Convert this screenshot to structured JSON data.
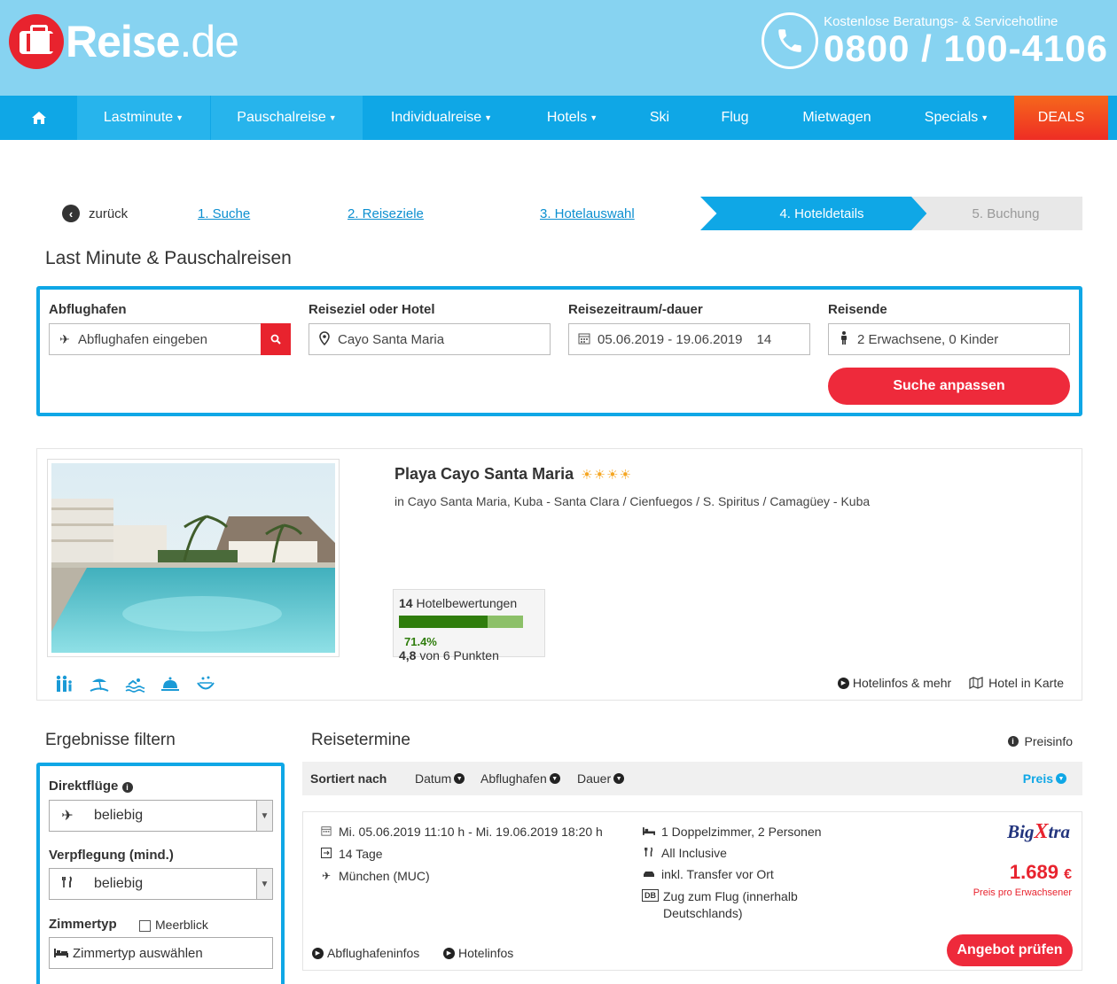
{
  "header": {
    "logo_bold": "Reise",
    "logo_light": ".de",
    "hotline_label": "Kostenlose Beratungs- & Servicehotline",
    "hotline_number": "0800 / 100-4106"
  },
  "nav": {
    "items": [
      {
        "label": "Lastminute"
      },
      {
        "label": "Pauschalreise"
      },
      {
        "label": "Individualreise"
      },
      {
        "label": "Hotels"
      },
      {
        "label": "Ski"
      },
      {
        "label": "Flug"
      },
      {
        "label": "Mietwagen"
      },
      {
        "label": "Specials"
      },
      {
        "label": "DEALS"
      }
    ]
  },
  "steps": {
    "back": "zurück",
    "items": [
      "1. Suche",
      "2. Reiseziele",
      "3. Hotelauswahl",
      "4. Hoteldetails",
      "5. Buchung"
    ]
  },
  "page_title": "Last Minute & Pauschalreisen",
  "search": {
    "departure_label": "Abflughafen",
    "departure_placeholder": "Abflughafen eingeben",
    "destination_label": "Reiseziel oder Hotel",
    "destination_value": "Cayo Santa Maria",
    "period_label": "Reisezeitraum/-dauer",
    "period_value": "05.06.2019 - 19.06.2019",
    "duration_value": "14",
    "travelers_label": "Reisende",
    "travelers_value": "2 Erwachsene, 0 Kinder",
    "submit": "Suche anpassen"
  },
  "hotel": {
    "name": "Playa Cayo Santa Maria",
    "stars": "☀☀☀☀",
    "location": "in Cayo Santa Maria, Kuba - Santa Clara / Cienfuegos / S. Spiritus / Camagüey - Kuba",
    "reviews_count": "14",
    "reviews_label": "Hotelbewertungen",
    "recommend_pct": 71.4,
    "recommend_text": "71.4%",
    "score": "4,8",
    "score_suffix": "von 6 Punkten",
    "link_info": "Hotelinfos & mehr",
    "link_map": "Hotel in Karte",
    "amenities": [
      "family-icon",
      "beach-icon",
      "pool-icon",
      "service-bell-icon",
      "spa-icon"
    ]
  },
  "filter": {
    "title": "Ergebnisse filtern",
    "direct_label": "Direktflüge",
    "direct_value": "beliebig",
    "board_label": "Verpflegung (mind.)",
    "board_value": "beliebig",
    "room_label": "Zimmertyp",
    "seaview_label": "Meerblick",
    "room_placeholder": "Zimmertyp auswählen"
  },
  "results": {
    "title": "Reisetermine",
    "price_info": "Preisinfo",
    "sort_label": "Sortiert nach",
    "sort_options": [
      "Datum",
      "Abflughafen",
      "Dauer"
    ],
    "sort_active": "Preis"
  },
  "offer": {
    "dates": "Mi. 05.06.2019 11:10 h - Mi. 19.06.2019 18:20 h",
    "duration": "14 Tage",
    "airport": "München (MUC)",
    "room": "1 Doppelzimmer, 2 Personen",
    "board": "All Inclusive",
    "transfer": "inkl. Transfer vor Ort",
    "train_line1": "Zug zum Flug (innerhalb",
    "train_line2": "Deutschlands)",
    "operator_a": "Big",
    "operator_b": "X",
    "operator_c": "tra",
    "price": "1.689",
    "currency": "€",
    "price_note": "Preis pro Erwachsener",
    "cta": "Angebot prüfen",
    "link_airport": "Abflughafeninfos",
    "link_hotel": "Hotelinfos"
  }
}
